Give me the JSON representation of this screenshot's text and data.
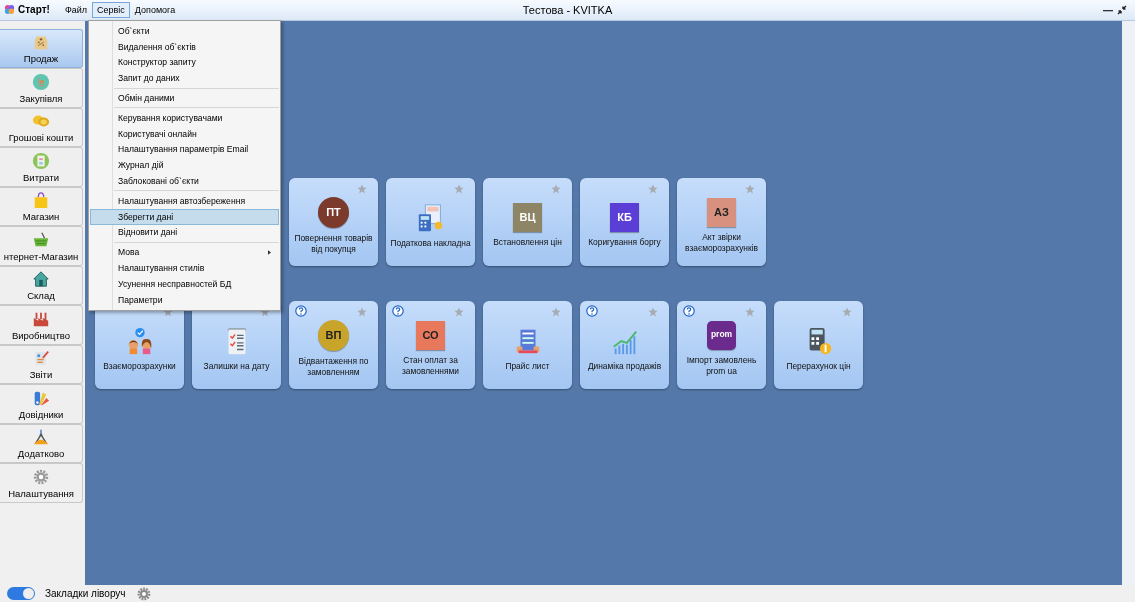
{
  "app": {
    "name": "Старт!"
  },
  "menubar": [
    {
      "label": "Файл",
      "selected": false
    },
    {
      "label": "Сервіс",
      "selected": true
    },
    {
      "label": "Допомога",
      "selected": false
    }
  ],
  "window": {
    "title": "Тестова - KVITKA"
  },
  "sidebar": {
    "items": [
      {
        "label": "Продаж",
        "selected": true
      },
      {
        "label": "Закупівля",
        "selected": false
      },
      {
        "label": "Грошові кошти",
        "selected": false
      },
      {
        "label": "Витрати",
        "selected": false
      },
      {
        "label": "Магазин",
        "selected": false
      },
      {
        "label": "нтернет-Магазин",
        "selected": false
      },
      {
        "label": "Склад",
        "selected": false
      },
      {
        "label": "Виробництво",
        "selected": false
      },
      {
        "label": "Звіти",
        "selected": false
      },
      {
        "label": "Довідники",
        "selected": false
      },
      {
        "label": "Додатково",
        "selected": false
      },
      {
        "label": "Налаштування",
        "selected": false
      }
    ]
  },
  "service_menu": {
    "groups": [
      [
        {
          "label": "Об`єкти",
          "selected": false,
          "submenu": false
        },
        {
          "label": "Видалення об`єктів",
          "selected": false,
          "submenu": false
        },
        {
          "label": "Конструктор запиту",
          "selected": false,
          "submenu": false
        },
        {
          "label": "Запит до даних",
          "selected": false,
          "submenu": false
        }
      ],
      [
        {
          "label": "Обмін даними",
          "selected": false,
          "submenu": false
        }
      ],
      [
        {
          "label": "Керування користувачами",
          "selected": false,
          "submenu": false
        },
        {
          "label": "Користувачі онлайн",
          "selected": false,
          "submenu": false
        },
        {
          "label": "Налаштування параметрів Email",
          "selected": false,
          "submenu": false
        },
        {
          "label": "Журнал дій",
          "selected": false,
          "submenu": false
        },
        {
          "label": "Заблоковані об`єкти",
          "selected": false,
          "submenu": false
        }
      ],
      [
        {
          "label": "Налаштування автозбереження",
          "selected": false,
          "submenu": false
        },
        {
          "label": "Зберегти дані",
          "selected": true,
          "submenu": false
        },
        {
          "label": "Відновити дані",
          "selected": false,
          "submenu": false
        }
      ],
      [
        {
          "label": "Мова",
          "selected": false,
          "submenu": true
        },
        {
          "label": "Налаштування стилів",
          "selected": false,
          "submenu": false
        },
        {
          "label": "Усунення несправностей БД",
          "selected": false,
          "submenu": false
        },
        {
          "label": "Параметри",
          "selected": false,
          "submenu": false
        }
      ]
    ]
  },
  "tile_rows": [
    {
      "tiles": [
        {
          "kind": "circle-badge",
          "badge": "ПТ",
          "color": "#7b3a2c",
          "label": "Повернення товарів від покупця",
          "help": false
        },
        {
          "kind": "icon",
          "label": "Податкова накладна",
          "help": false
        },
        {
          "kind": "square-badge",
          "badge": "ВЦ",
          "color": "#8e8466",
          "label": "Встановлення цін",
          "help": false
        },
        {
          "kind": "square-badge",
          "badge": "КБ",
          "color": "#5b3ed6",
          "label": "Коригування боргу",
          "help": false
        },
        {
          "kind": "square-badge",
          "badge": "АЗ",
          "color": "#d9917f",
          "label": "Акт звірки взаєморозрахунків",
          "help": false
        }
      ]
    },
    {
      "tiles": [
        {
          "kind": "icon",
          "label": "Взаєморозрахунки",
          "help": false
        },
        {
          "kind": "icon",
          "label": "Залишки на дату",
          "help": false
        },
        {
          "kind": "circle-badge",
          "badge": "ВП",
          "color": "#c9a42a",
          "label": "Відвантаження по замовленням",
          "help": true
        },
        {
          "kind": "square-badge",
          "badge": "СО",
          "color": "#e8785b",
          "label": "Стан оплат за замовленнями",
          "help": true
        },
        {
          "kind": "icon",
          "label": "Прайс лист",
          "help": false
        },
        {
          "kind": "icon",
          "label": "Динаміка продажів",
          "help": true
        },
        {
          "kind": "rounded-badge",
          "badge": "prom",
          "color": "#6a2b8c",
          "label": "Імпорт замовлень prom ua",
          "help": true
        },
        {
          "kind": "icon",
          "label": "Перерахунок цін",
          "help": false
        }
      ]
    }
  ],
  "footer": {
    "toggle": {
      "checked": true,
      "label": "Закладки ліворуч"
    }
  }
}
